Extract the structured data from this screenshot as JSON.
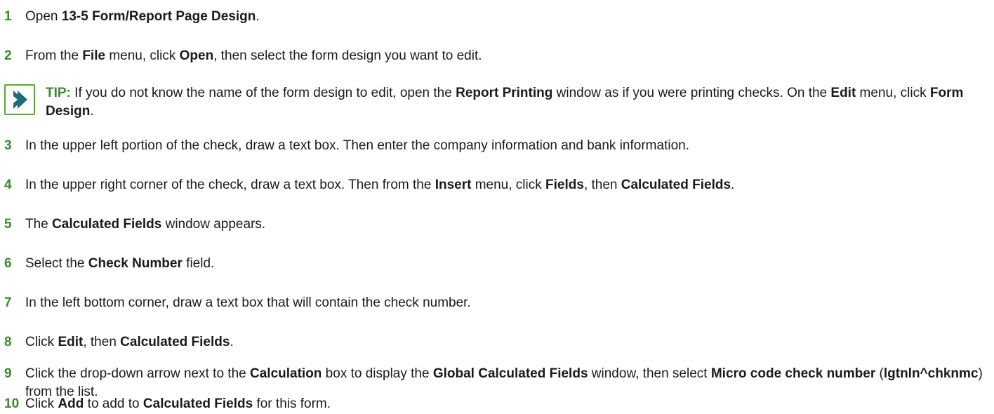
{
  "steps": [
    {
      "n": "1",
      "parts": [
        [
          "Open ",
          false
        ],
        [
          "13-5 Form/Report Page Design",
          true
        ],
        [
          ".",
          false
        ]
      ]
    },
    {
      "n": "2",
      "parts": [
        [
          "From the ",
          false
        ],
        [
          "File",
          true
        ],
        [
          " menu, click ",
          false
        ],
        [
          "Open",
          true
        ],
        [
          ", then select the form design you want to edit.",
          false
        ]
      ]
    },
    {
      "n": "3",
      "parts": [
        [
          "In the upper left portion of the check, draw a text box. Then enter the company information and bank information.",
          false
        ]
      ]
    },
    {
      "n": "4",
      "parts": [
        [
          "In the upper right corner of the check, draw a text box. Then from the ",
          false
        ],
        [
          "Insert",
          true
        ],
        [
          " menu, click ",
          false
        ],
        [
          "Fields",
          true
        ],
        [
          ", then ",
          false
        ],
        [
          "Calculated Fields",
          true
        ],
        [
          ".",
          false
        ]
      ]
    },
    {
      "n": "5",
      "parts": [
        [
          "The ",
          false
        ],
        [
          "Calculated Fields",
          true
        ],
        [
          " window appears.",
          false
        ]
      ]
    },
    {
      "n": "6",
      "parts": [
        [
          "Select the ",
          false
        ],
        [
          "Check Number",
          true
        ],
        [
          " field.",
          false
        ]
      ]
    },
    {
      "n": "7",
      "parts": [
        [
          "In the left bottom corner, draw a text box that will contain the check number.",
          false
        ]
      ]
    },
    {
      "n": "8",
      "parts": [
        [
          "Click ",
          false
        ],
        [
          "Edit",
          true
        ],
        [
          ", then ",
          false
        ],
        [
          "Calculated Fields",
          true
        ],
        [
          ".",
          false
        ]
      ]
    },
    {
      "n": "9",
      "parts": [
        [
          "Click the drop-down arrow next to the ",
          false
        ],
        [
          "Calculation",
          true
        ],
        [
          " box to display the ",
          false
        ],
        [
          "Global Calculated Fields",
          true
        ],
        [
          " window, then select ",
          false
        ],
        [
          "Micro code check number",
          true
        ],
        [
          " (",
          false
        ],
        [
          "lgtnln^chknmc",
          true
        ],
        [
          ") from the list.",
          false
        ]
      ]
    },
    {
      "n": "10",
      "parts": [
        [
          "Click ",
          false
        ],
        [
          "Add",
          true
        ],
        [
          " to add to ",
          false
        ],
        [
          "Calculated Fields",
          true
        ],
        [
          " for this form.",
          false
        ]
      ]
    }
  ],
  "tip": {
    "label": "TIP:",
    "parts": [
      [
        "  If you do not know the name of the form design to edit, open the ",
        false
      ],
      [
        "Report Printing",
        true
      ],
      [
        " window as if you were printing checks. On the ",
        false
      ],
      [
        "Edit",
        true
      ],
      [
        " menu, click ",
        false
      ],
      [
        "Form Design",
        true
      ],
      [
        ".",
        false
      ]
    ],
    "icon": "chevron-right-icon",
    "accent": "#3d8a2d"
  }
}
